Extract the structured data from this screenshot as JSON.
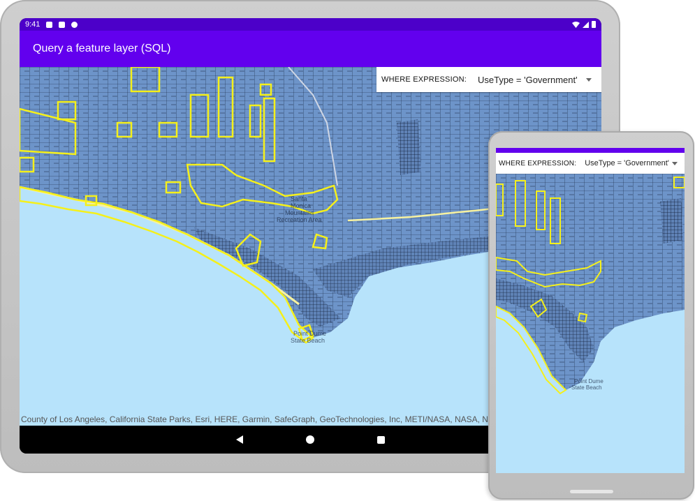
{
  "status_bar": {
    "time": "9:41"
  },
  "app_bar": {
    "title": "Query a feature layer (SQL)"
  },
  "where_bar": {
    "label": "WHERE EXPRESSION:",
    "selected_value": "UseType = 'Government'"
  },
  "map": {
    "labels": [
      "Santa",
      "Monica",
      "Mountains",
      "Recreation Area",
      "Point Dume",
      "State Beach"
    ],
    "attribution": "County of Los Angeles, California State Parks, Esri, HERE, Garmin, SafeGraph, GeoTechnologies, Inc, METI/NASA, NASA, NGA,",
    "colors": {
      "land": "#6d94c9",
      "water": "#b7e3fb",
      "highlight": "#f5f01a",
      "parcel_lines": "#14213a"
    }
  },
  "nav_bar": {
    "icons": [
      "back-icon",
      "home-icon",
      "recent-apps-icon"
    ]
  },
  "colors": {
    "status_bar": "#4c00c9",
    "app_bar": "#6200ee"
  }
}
